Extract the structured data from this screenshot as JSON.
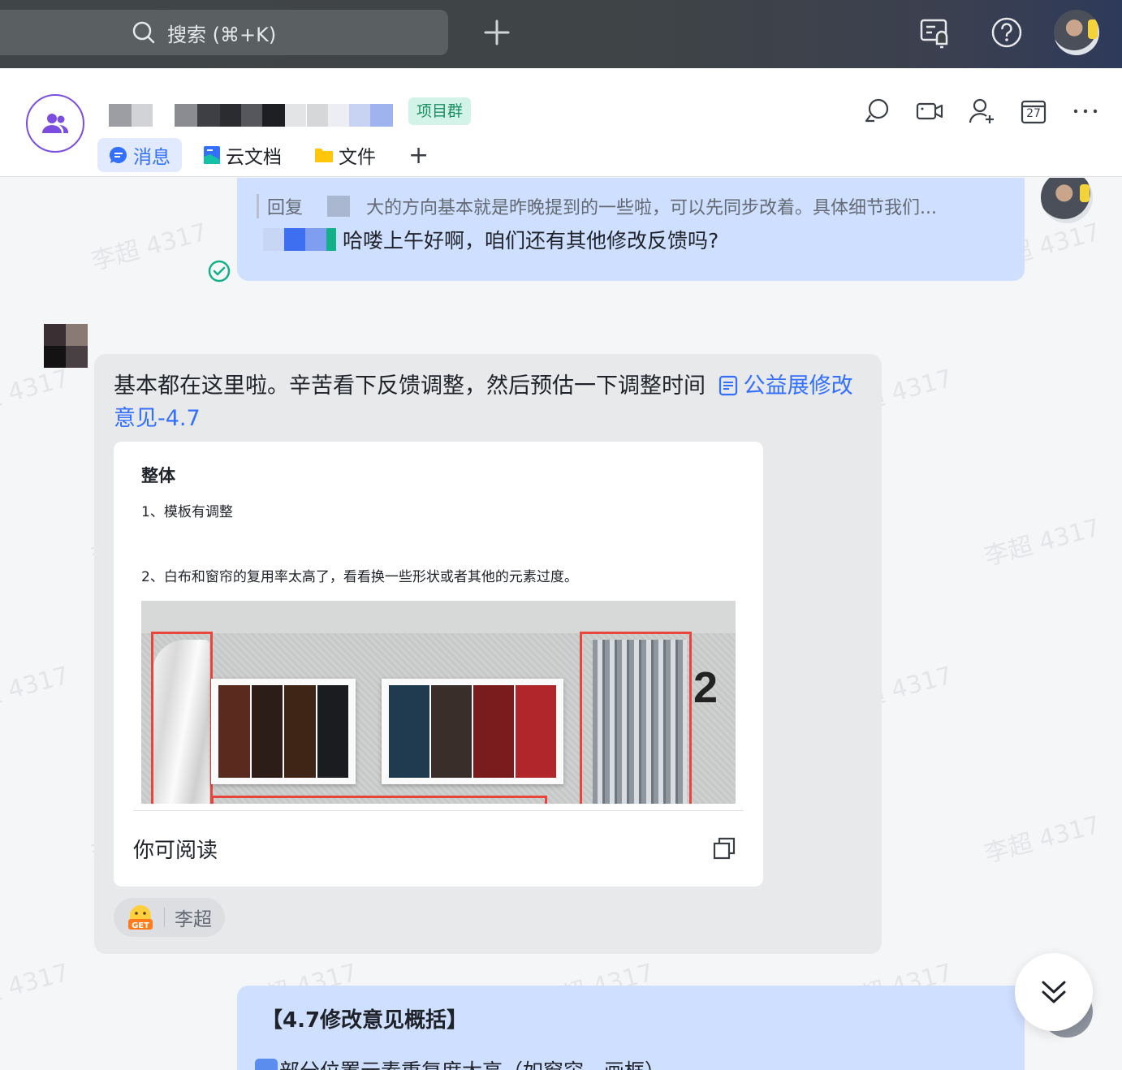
{
  "topbar": {
    "search_placeholder": "搜索 (⌘+K)",
    "icons": [
      "search-icon",
      "plus-icon",
      "notification-icon",
      "help-icon",
      "avatar"
    ]
  },
  "header": {
    "tag": "项目群",
    "tabs": [
      {
        "label": "消息",
        "icon": "message-icon",
        "active": true
      },
      {
        "label": "云文档",
        "icon": "cloud-doc-icon",
        "active": false
      },
      {
        "label": "文件",
        "icon": "folder-icon",
        "active": false
      }
    ],
    "add_tab": "+",
    "icons": [
      "chat-search-icon",
      "video-call-icon",
      "add-member-icon",
      "calendar-icon",
      "more-icon"
    ],
    "calendar_day": "27"
  },
  "messages": {
    "reply": {
      "prefix": "回复",
      "quote": "大的方向基本就是昨晚提到的一些啦，可以先同步改着。具体细节我们..."
    },
    "me_text": "哈喽上午好啊，咱们还有其他修改反馈吗?",
    "other": {
      "text": "基本都在这里啦。辛苦看下反馈调整，然后预估一下调整时间",
      "link": "公益展修改意见-4.7",
      "card": {
        "heading": "整体",
        "item1": "1、模板有调整",
        "item2": "2、白布和窗帘的复用率太高了，看看换一些形状或者其他的元素过度。",
        "footer": "你可阅读"
      },
      "reaction_user": "李超"
    },
    "me2_title": "【4.7修改意见概括】",
    "me2_line": "部分位置元素重复度太高（如窗帘、画框）"
  },
  "watermark": "李超 4317",
  "colors": {
    "accent": "#3370ff",
    "my_bubble": "#cfdfff",
    "other_bubble": "#e8e9eb",
    "tag_bg": "#d4f3e8",
    "tag_text": "#1a8f65",
    "group_ring": "#7b4ee0"
  }
}
